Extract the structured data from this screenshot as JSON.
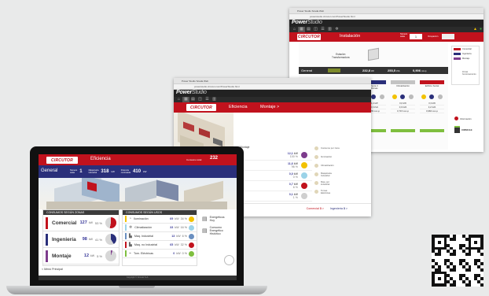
{
  "back_window": {
    "tab_title": "Power Studio Scada Web",
    "url": "powerstudio.circutor.com/PowerStudio.html",
    "brand_logo_text": "Power",
    "brand_logo_sub": "Studio",
    "circutor_label": "CIRCUTOR",
    "page_title": "Instalación",
    "selector_label": "Número\nsalas",
    "selector_value": "1",
    "selector_label2": "Ocupación",
    "center_label": "Estación\nTransformadora",
    "general_label": "General",
    "general_values": [
      {
        "value": "232,8",
        "unit": "kW"
      },
      {
        "value": "253,5",
        "unit": "kVA"
      },
      {
        "value": "0,906",
        "unit": "cos φ"
      }
    ],
    "columns": [
      {
        "title": "Planta 1\nAlmacén / Montaje",
        "color": "#7d3c8c",
        "v1": "27,3 kW",
        "v2": "25,9 kVA",
        "v3": "0,945 cos φ"
      },
      {
        "title": "Planta 2\nIngeniería",
        "color": "#2a2f7a",
        "v1": "129,6 kW",
        "v2": "145,7 kVA",
        "v3": "0,891 cos φ"
      },
      {
        "title": "Planta 3\nOficinas",
        "color": "#2a2f7a",
        "v1": "44,4 kW",
        "v2": "44,9 kVA",
        "v3": "0,989 cos φ"
      },
      {
        "title": "Climatización",
        "color": "#c3c3c3",
        "v1": "0,0 kW",
        "v2": "0,0 kVA",
        "v3": "0,715 cos φ"
      },
      {
        "title": "Edificio Social",
        "color": "#c1121d",
        "v1": "3,3 kW",
        "v2": "3,2 kVA",
        "v3": "0,984 cos φ"
      }
    ],
    "legend": [
      "Comercial",
      "Ingeniería",
      "Montaje"
    ],
    "legend_colors": [
      "#c1121d",
      "#2a2f7a",
      "#7d3c8c"
    ],
    "status_label": "Zonas\nfuncionamiento",
    "info_label": "Información",
    "brand_right": "CIRMULE",
    "footer_link": "Menú Principal"
  },
  "middle_window": {
    "tab_title": "Power Studio Scada Web",
    "url": "powerstudio.circutor.com/PowerStudio.html",
    "circutor_label": "CIRCUTOR",
    "tabs": [
      "Eficiencia",
      "Montaje"
    ],
    "montaje_label": "Montaje",
    "rows": [
      {
        "icon": "sun-icon",
        "value": "12,1",
        "unit": "kW",
        "pct": "100 %",
        "dot": "#7d3c8c"
      },
      {
        "icon": "bulb-icon",
        "value": "11,6",
        "unit": "kW",
        "pct": "96 %",
        "dot": "#f2c200"
      },
      {
        "icon": "snow-icon",
        "value": "0,0",
        "unit": "kW",
        "pct": "0 %",
        "dot": "#9bd3e8"
      },
      {
        "icon": "plug-icon",
        "value": "0,7",
        "unit": "kW",
        "pct": "6 %",
        "dot": "#c1121d"
      },
      {
        "icon": "circle-icon",
        "value": "0,1",
        "unit": "kW",
        "pct": "1 %",
        "dot": "#cfcfcf"
      }
    ],
    "side_items": [
      "Consumo por zona",
      "Iluminación",
      "Climatización",
      "Maquinaria\nIndustrial",
      "Maq. por\nindustrial",
      "Tomas\nEléctricas"
    ],
    "footer_left": "Eficiencia",
    "footer_links": [
      "Comercial",
      "Ingeniería"
    ],
    "footer_num": [
      "3",
      "3"
    ]
  },
  "laptop_screen": {
    "circutor_label": "CIRCUTOR",
    "title": "Eficiencia",
    "header_right_label": "Consumo total",
    "header_right_value": "232",
    "general_label": "General",
    "stats": [
      {
        "label": "Número\nsalas",
        "value": "1"
      },
      {
        "label": "Maquinaria\nIndustrial",
        "value": "318",
        "unit": "kW"
      },
      {
        "label": "Potencia\ncontratada",
        "value": "410",
        "unit": "kW"
      }
    ],
    "zones_header": "CONSUMOS SEGÚN ZONAS",
    "zones": [
      {
        "name": "Comercial",
        "value": "127",
        "unit": "kW",
        "pct": "53 %",
        "color": "#c1121d",
        "pie": "#c1121d",
        "pie_pct": 53
      },
      {
        "name": "Ingeniería",
        "value": "98",
        "unit": "kW",
        "pct": "41 %",
        "color": "#2a2f7a",
        "pie": "#2a2f7a",
        "pie_pct": 41
      },
      {
        "name": "Montaje",
        "value": "12",
        "unit": "kW",
        "pct": "5 %",
        "color": "#7d3c8c",
        "pie": "#7d3c8c",
        "pie_pct": 5
      }
    ],
    "uses_header": "CONSUMOS SEGÚN USOS",
    "uses": [
      {
        "icon": "bulb-icon",
        "name": "Iluminación",
        "value": "69",
        "unit": "kW",
        "pct": "34 %",
        "color": "#f2c200"
      },
      {
        "icon": "snow-icon",
        "name": "Climatización",
        "value": "33",
        "unit": "kW",
        "pct": "16 %",
        "color": "#9bd3e8"
      },
      {
        "icon": "factory-icon",
        "name": "Maq. Industrial",
        "value": "13",
        "unit": "kW",
        "pct": "6 %",
        "color": "#6a8fc0"
      },
      {
        "icon": "factory-icon",
        "name": "Maq. no Industrial",
        "value": "65",
        "unit": "kW",
        "pct": "32 %",
        "color": "#c1121d"
      },
      {
        "icon": "plug-icon",
        "name": "Tom. Eléctricas",
        "value": "0",
        "unit": "kW",
        "pct": "0 %",
        "color": "#7fbf3f"
      }
    ],
    "energy": [
      {
        "label": "Energéticos\nHoy"
      },
      {
        "label": "Consumo\nEnergético\nHistórico"
      }
    ],
    "footer_link": "Menú Principal",
    "footer_caption": "Copyright © Circutor S.A."
  }
}
